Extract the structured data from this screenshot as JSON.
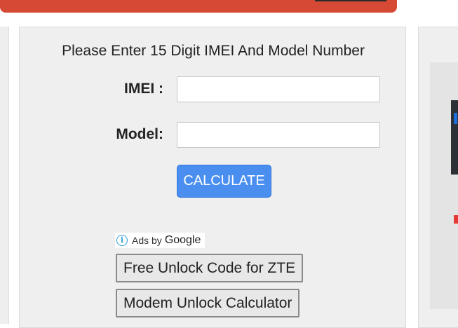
{
  "form": {
    "heading": "Please Enter 15 Digit IMEI And Model Number",
    "imei_label": "IMEI :",
    "imei_value": "",
    "model_label": "Model:",
    "model_value": "",
    "calculate_label": "CALCULATE"
  },
  "ads": {
    "ads_by_label": "Ads by",
    "provider": "Google",
    "links": [
      "Free Unlock Code for ZTE",
      "Modem Unlock Calculator"
    ]
  },
  "colors": {
    "banner": "#d64a35",
    "button": "#4a8ff0",
    "panel_bg": "#efefef"
  }
}
